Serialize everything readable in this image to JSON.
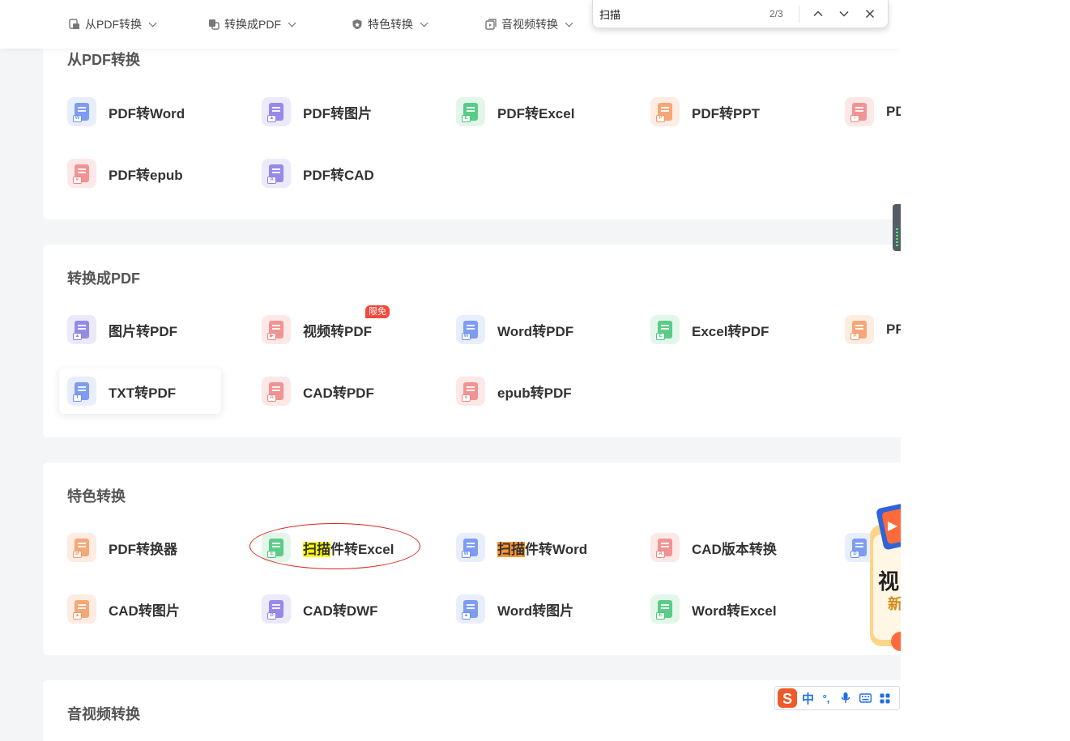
{
  "nav": {
    "items": [
      {
        "label": "从PDF转换"
      },
      {
        "label": "转换成PDF"
      },
      {
        "label": "特色转换"
      },
      {
        "label": "音视频转换"
      }
    ]
  },
  "find": {
    "query": "扫描",
    "count": "2/3"
  },
  "sections": {
    "from_pdf": {
      "title": "从PDF转换",
      "tools": [
        "PDF转Word",
        "PDF转图片",
        "PDF转Excel",
        "PDF转PPT",
        "PD",
        "PDF转epub",
        "PDF转CAD"
      ]
    },
    "to_pdf": {
      "title": "转换成PDF",
      "tools": [
        "图片转PDF",
        "视频转PDF",
        "Word转PDF",
        "Excel转PDF",
        "PP",
        "TXT转PDF",
        "CAD转PDF",
        "epub转PDF"
      ],
      "badge": "限免"
    },
    "special": {
      "title": "特色转换",
      "tools": [
        "PDF转换器",
        "CAD版本转换",
        "CAD转图片",
        "CAD转DWF",
        "Word转图片",
        "Word转Excel"
      ],
      "scan_excel": {
        "match": "扫描",
        "rest": "件转Excel"
      },
      "scan_word": {
        "match": "扫描",
        "rest": "件转Word"
      }
    },
    "av": {
      "title": "音视频转换"
    }
  },
  "promo": {
    "text1": "视",
    "text2": "新"
  },
  "ime": {
    "label": "中",
    "punct": "°,"
  }
}
